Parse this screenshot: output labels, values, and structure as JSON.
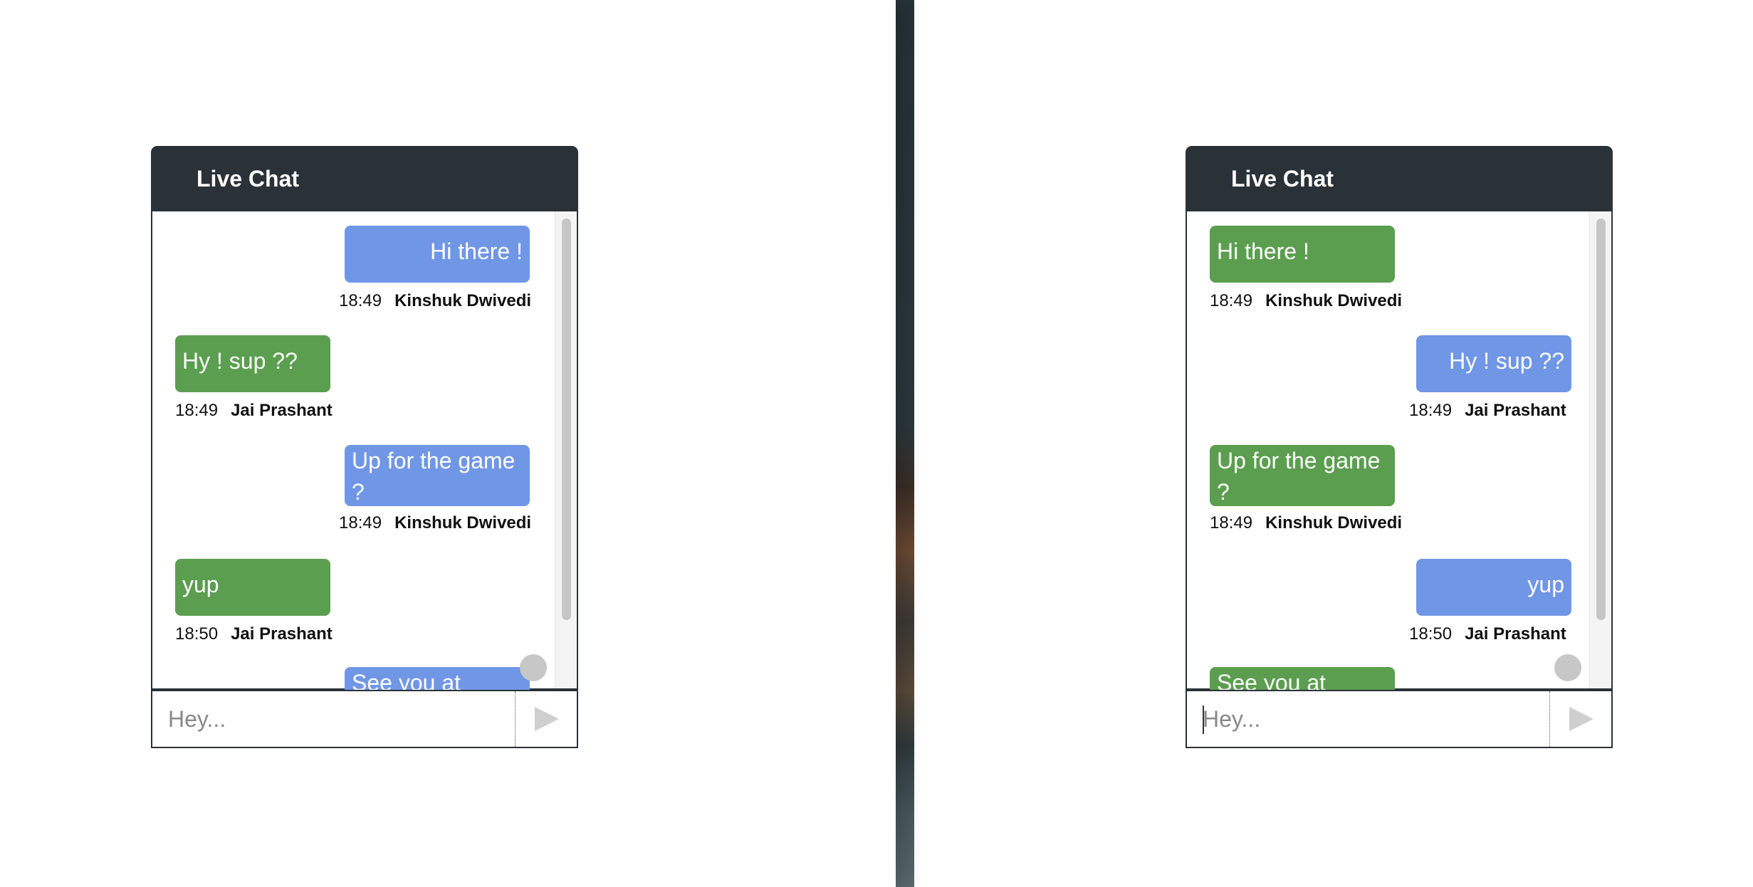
{
  "chats": [
    {
      "title": "Live Chat",
      "input_placeholder": "Hey...",
      "messages": [
        {
          "text": "Hi there !",
          "time": "18:49",
          "sender": "Kinshuk Dwivedi",
          "side": "right",
          "color": "#7096e6"
        },
        {
          "text": "Hy ! sup ??",
          "time": "18:49",
          "sender": "Jai Prashant",
          "side": "left",
          "color": "#5b9e4f"
        },
        {
          "text": "Up for the game ?",
          "time": "18:49",
          "sender": "Kinshuk Dwivedi",
          "side": "right",
          "color": "#7096e6"
        },
        {
          "text": "yup",
          "time": "18:50",
          "sender": "Jai Prashant",
          "side": "left",
          "color": "#5b9e4f"
        },
        {
          "text": "See you at",
          "time": "",
          "sender": "",
          "side": "right",
          "color": "#7096e6"
        }
      ]
    },
    {
      "title": "Live Chat",
      "input_placeholder": "Hey...",
      "messages": [
        {
          "text": "Hi there !",
          "time": "18:49",
          "sender": "Kinshuk Dwivedi",
          "side": "left",
          "color": "#5b9e4f"
        },
        {
          "text": "Hy ! sup ??",
          "time": "18:49",
          "sender": "Jai Prashant",
          "side": "right",
          "color": "#7096e6"
        },
        {
          "text": "Up for the game ?",
          "time": "18:49",
          "sender": "Kinshuk Dwivedi",
          "side": "left",
          "color": "#5b9e4f"
        },
        {
          "text": "yup",
          "time": "18:50",
          "sender": "Jai Prashant",
          "side": "right",
          "color": "#7096e6"
        },
        {
          "text": "See you at",
          "time": "",
          "sender": "",
          "side": "left",
          "color": "#5b9e4f"
        }
      ]
    }
  ],
  "icons": {
    "send": "send-icon",
    "scroll": "scroll-indicator"
  }
}
